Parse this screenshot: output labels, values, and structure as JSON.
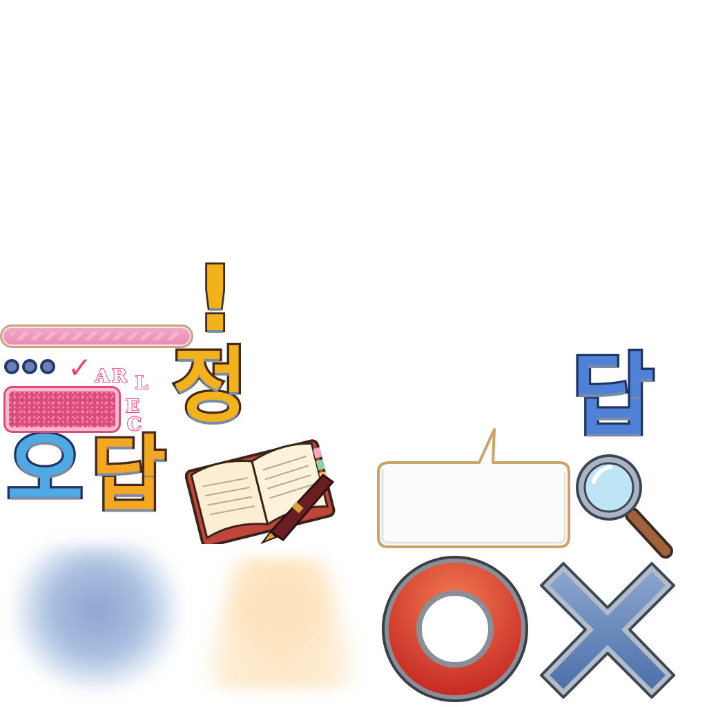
{
  "glyphs": {
    "exclaim": "!",
    "jeong": "정",
    "o": "오",
    "dap_left": "답",
    "dap_right": "답"
  },
  "stamp": {
    "check": "✓",
    "letters": [
      "A",
      "R",
      "L",
      "E",
      "C"
    ]
  },
  "icons": {
    "notebook": "open-notebook-icon",
    "pen": "fountain-pen-icon",
    "bubble": "speech-bubble-icon",
    "magnifier": "magnifier-icon",
    "correct": "circle-o-icon",
    "wrong": "cross-x-icon"
  },
  "colors": {
    "pink_bar": "#f4a9c6",
    "pink_box": "#e04a7a",
    "gold": "#f2b21c",
    "blue": "#4f82d6",
    "red": "#e03b2a",
    "slate_blue": "#5a7fb8"
  }
}
